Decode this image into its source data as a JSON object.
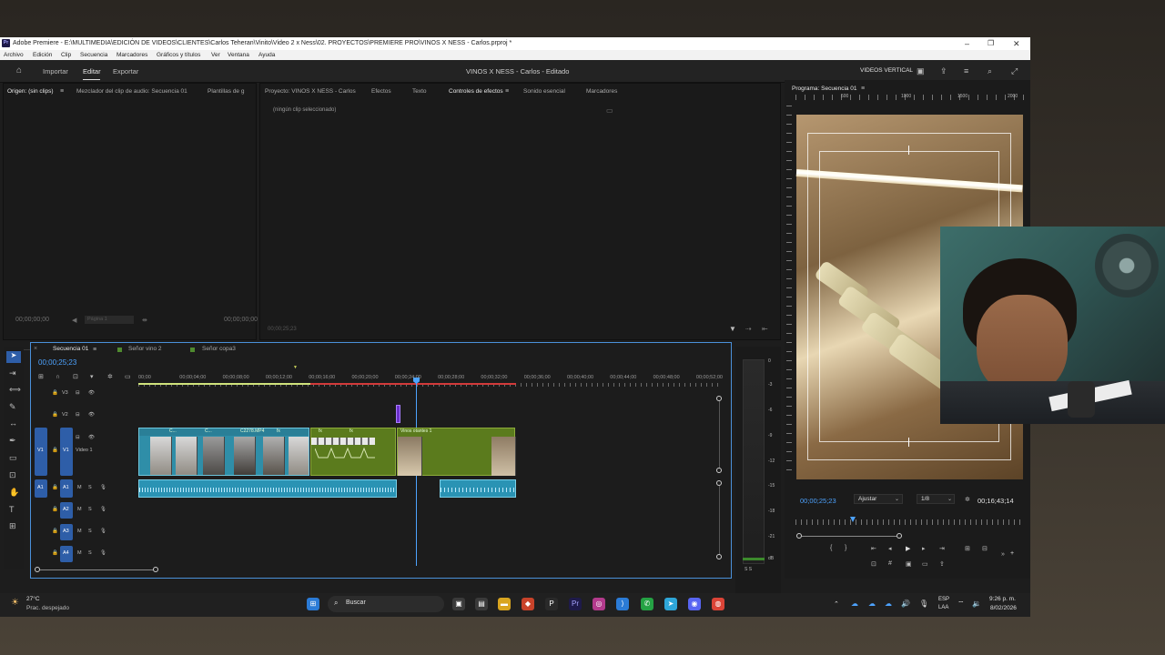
{
  "window": {
    "title": "Adobe Premiere - E:\\MULTIMEDIA\\EDICIÓN DE VIDEOS\\CLIENTES\\Carlos Teheran\\Vinito\\Video 2 x Ness\\02. PROYECTOS\\PREMIERE PRO\\VINOS X NESS - Carlos.prproj *",
    "logo": "Pr"
  },
  "menu": [
    "Archivo",
    "Edición",
    "Clip",
    "Secuencia",
    "Marcadores",
    "Gráficos y títulos",
    "Ver",
    "Ventana",
    "Ayuda"
  ],
  "workspace": {
    "tabs": [
      "Importar",
      "Editar",
      "Exportar"
    ],
    "active_tab": "Editar",
    "project_title": "VINOS X NESS - Carlos - Editado",
    "right_label": "VIDEOS VERTICAL"
  },
  "source_panel": {
    "tabs": [
      "Origen: (sin clips)",
      "Mezclador del clip de audio: Secuencia 01",
      "Plantillas de g"
    ],
    "tc_left": "00;00;00;00",
    "tc_right": "00;00;00;00",
    "page_label": "Página 1"
  },
  "effects_panel": {
    "tabs": [
      "Proyecto: VINOS X NESS - Carlos",
      "Efectos",
      "Texto",
      "Controles de efectos",
      "Sonido esencial",
      "Marcadores"
    ],
    "active_tab": "Controles de efectos",
    "empty_text": "(ningún clip seleccionado)",
    "footer_tc": "00;00;25;23"
  },
  "timeline": {
    "tabs": [
      "Secuencia 01",
      "Señor vino 2",
      "Señor copa3"
    ],
    "timecode": "00;00;25;23",
    "ruler": [
      "00;00",
      "00;00;04;00",
      "00;00;08;00",
      "00;00;12;00",
      "00;00;16;00",
      "00;00;20;00",
      "00;00;24;00",
      "00;00;28;00",
      "00;00;32;00",
      "00;00;36;00",
      "00;00;40;00",
      "00;00;44;00",
      "00;00;48;00",
      "00;00;52;00"
    ],
    "video_tracks": [
      "V3",
      "V2",
      "V1"
    ],
    "video1_name": "Video 1",
    "audio_tracks": [
      "A1",
      "A2",
      "A3",
      "A4"
    ],
    "clip_labels": [
      "C...",
      "C...",
      "C2278.MP4",
      "fx",
      "fx",
      "fx",
      "Vinos otantes 1"
    ],
    "meter_labels": [
      "0",
      "-3",
      "-6",
      "-9",
      "-12",
      "-15",
      "-18",
      "-21",
      "dB"
    ],
    "meter_footer": "S S"
  },
  "program": {
    "title": "Programa: Secuencia 01",
    "ruler": [
      "500",
      "1000",
      "1500",
      "2000"
    ],
    "timecode": "00;00;25;23",
    "fit": "Ajustar",
    "resolution": "1/8",
    "duration": "00;16;43;14"
  },
  "taskbar": {
    "temp": "27°C",
    "weather": "Prac. despejado",
    "search": "Buscar",
    "lang_line1": "ESP",
    "lang_line2": "LAA",
    "time": "9:26 p. m.",
    "date": "8/02/2026"
  }
}
